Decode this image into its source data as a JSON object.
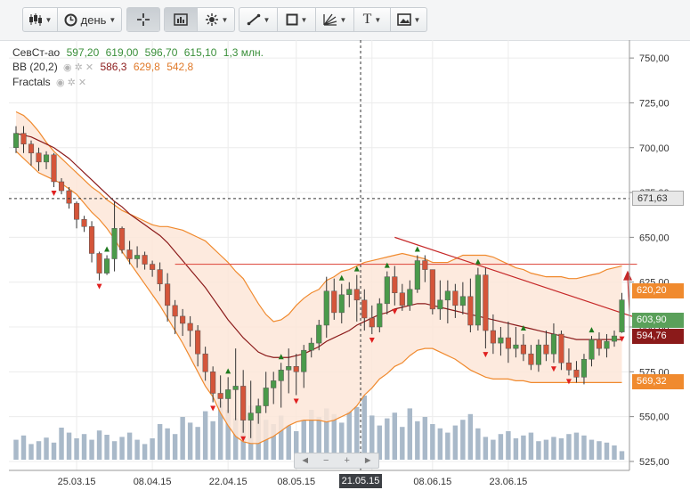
{
  "toolbar": {
    "buttons": [
      {
        "name": "chart-type-button",
        "icon": "candlestick-icon",
        "caret": true
      },
      {
        "name": "interval-button",
        "icon": "clock-icon",
        "label": "день",
        "caret": true
      },
      {
        "name": "crosshair-button",
        "icon": "crosshair-icon",
        "active": true
      },
      {
        "name": "chart-style-button",
        "icon": "chart-box-icon",
        "active": true
      },
      {
        "name": "theme-button",
        "icon": "sun-icon",
        "caret": true
      },
      {
        "name": "line-tool-button",
        "icon": "pencil-line-icon",
        "caret": true
      },
      {
        "name": "shape-tool-button",
        "icon": "square-icon",
        "caret": true
      },
      {
        "name": "fib-tool-button",
        "icon": "fan-icon",
        "caret": true
      },
      {
        "name": "text-tool-button",
        "icon": "text-icon",
        "label": "T",
        "caret": true
      },
      {
        "name": "image-tool-button",
        "icon": "image-icon",
        "caret": true
      }
    ]
  },
  "legend": {
    "ticker": "СевСт-ао",
    "ohlc": [
      "597,20",
      "619,00",
      "596,70",
      "615,10"
    ],
    "volume": "1,3 млн.",
    "bb_name": "BB (20,2)",
    "bb_values": [
      "586,3",
      "629,8",
      "542,8"
    ],
    "fractals_name": "Fractals"
  },
  "price_tags": [
    {
      "text": "671,63",
      "value": 671.63,
      "bg": "#e8e8e8",
      "color": "#333",
      "border": "#aaa"
    },
    {
      "text": "620,20",
      "value": 620.2,
      "bg": "#f08a2e",
      "color": "#fff"
    },
    {
      "text": "603,90",
      "value": 603.9,
      "bg": "#5aa05a",
      "color": "#fff"
    },
    {
      "text": "594,76",
      "value": 594.76,
      "bg": "#8b1a1a",
      "color": "#fff"
    },
    {
      "text": "569,32",
      "value": 569.32,
      "bg": "#f08a2e",
      "color": "#fff"
    }
  ],
  "crosshair_date": "21.05.15",
  "navigator": {
    "left": "◄",
    "minus": "−",
    "plus": "+",
    "right": "►"
  },
  "colors": {
    "up": "#4a9a4a",
    "down": "#d4553a",
    "band_fill": "#fde6d8",
    "band_line": "#f08a2e",
    "mid_line": "#8b1a1a",
    "volume": "#a9b9c9"
  },
  "chart_data": {
    "type": "candlestick",
    "ylim": [
      520,
      760
    ],
    "yticks": [
      525,
      550,
      575,
      600,
      625,
      650,
      675,
      700,
      725,
      750
    ],
    "ytick_labels": [
      "525,00",
      "550,00",
      "575,00",
      "600,00",
      "625,00",
      "650,00",
      "675,00",
      "700,00",
      "725,00",
      "750,00"
    ],
    "xtick_labels": [
      {
        "idx": 8,
        "label": "25.03.15"
      },
      {
        "idx": 18,
        "label": "08.04.15"
      },
      {
        "idx": 28,
        "label": "22.04.15"
      },
      {
        "idx": 37,
        "label": "08.05.15"
      },
      {
        "idx": 47,
        "label": "21.05.15"
      },
      {
        "idx": 55,
        "label": "08.06.15"
      },
      {
        "idx": 65,
        "label": "23.06.15"
      }
    ],
    "crosshair": {
      "idx": 45.5,
      "price": 671.63
    },
    "candles": [
      [
        700,
        712,
        697,
        708
      ],
      [
        708,
        712,
        697,
        702
      ],
      [
        702,
        704,
        690,
        697
      ],
      [
        697,
        700,
        687,
        692
      ],
      [
        692,
        698,
        688,
        696
      ],
      [
        696,
        697,
        678,
        681
      ],
      [
        681,
        683,
        674,
        676
      ],
      [
        676,
        678,
        666,
        669
      ],
      [
        669,
        670,
        655,
        660
      ],
      [
        660,
        662,
        653,
        656
      ],
      [
        656,
        659,
        636,
        641
      ],
      [
        641,
        642,
        626,
        630
      ],
      [
        630,
        640,
        629,
        638
      ],
      [
        638,
        670,
        631,
        655
      ],
      [
        655,
        656,
        641,
        643
      ],
      [
        643,
        648,
        635,
        638
      ],
      [
        638,
        645,
        633,
        640
      ],
      [
        640,
        642,
        632,
        635
      ],
      [
        635,
        637,
        628,
        632
      ],
      [
        632,
        636,
        620,
        624
      ],
      [
        624,
        630,
        603,
        612
      ],
      [
        612,
        615,
        596,
        606
      ],
      [
        606,
        610,
        595,
        602
      ],
      [
        602,
        606,
        589,
        598
      ],
      [
        598,
        601,
        578,
        585
      ],
      [
        585,
        589,
        570,
        575
      ],
      [
        575,
        578,
        558,
        563
      ],
      [
        563,
        573,
        555,
        560
      ],
      [
        560,
        572,
        552,
        565
      ],
      [
        565,
        588,
        548,
        567
      ],
      [
        567,
        576,
        541,
        548
      ],
      [
        548,
        570,
        538,
        552
      ],
      [
        552,
        560,
        546,
        556
      ],
      [
        556,
        575,
        552,
        566
      ],
      [
        566,
        575,
        557,
        570
      ],
      [
        570,
        580,
        555,
        576
      ],
      [
        576,
        588,
        563,
        578
      ],
      [
        578,
        585,
        562,
        575
      ],
      [
        575,
        590,
        566,
        587
      ],
      [
        587,
        594,
        583,
        591
      ],
      [
        591,
        604,
        587,
        601
      ],
      [
        601,
        628,
        594,
        620
      ],
      [
        620,
        627,
        604,
        608
      ],
      [
        608,
        624,
        602,
        618
      ],
      [
        618,
        625,
        611,
        621
      ],
      [
        621,
        629,
        603,
        615
      ],
      [
        615,
        621,
        598,
        605
      ],
      [
        605,
        612,
        596,
        600
      ],
      [
        600,
        616,
        597,
        613
      ],
      [
        613,
        631,
        607,
        628
      ],
      [
        628,
        634,
        612,
        619
      ],
      [
        619,
        624,
        609,
        612
      ],
      [
        612,
        626,
        609,
        621
      ],
      [
        621,
        640,
        619,
        637
      ],
      [
        637,
        640,
        625,
        632
      ],
      [
        632,
        632,
        607,
        610
      ],
      [
        610,
        626,
        604,
        615
      ],
      [
        615,
        626,
        602,
        620
      ],
      [
        620,
        624,
        605,
        612
      ],
      [
        612,
        625,
        607,
        617
      ],
      [
        617,
        627,
        597,
        601
      ],
      [
        601,
        633,
        598,
        629
      ],
      [
        629,
        633,
        588,
        598
      ],
      [
        598,
        607,
        585,
        591
      ],
      [
        591,
        600,
        584,
        594
      ],
      [
        594,
        603,
        580,
        588
      ],
      [
        588,
        600,
        583,
        590
      ],
      [
        590,
        596,
        581,
        585
      ],
      [
        585,
        590,
        576,
        579
      ],
      [
        579,
        593,
        575,
        590
      ],
      [
        590,
        598,
        581,
        585
      ],
      [
        585,
        602,
        580,
        596
      ],
      [
        596,
        598,
        576,
        580
      ],
      [
        580,
        588,
        573,
        576
      ],
      [
        576,
        581,
        569,
        572
      ],
      [
        572,
        585,
        568,
        582
      ],
      [
        582,
        595,
        578,
        593
      ],
      [
        593,
        597,
        584,
        588
      ],
      [
        588,
        596,
        583,
        592
      ],
      [
        592,
        598,
        589,
        595
      ],
      [
        597.2,
        619,
        596.7,
        615.1
      ]
    ],
    "volumes": [
      0.28,
      0.34,
      0.22,
      0.26,
      0.31,
      0.24,
      0.45,
      0.38,
      0.3,
      0.36,
      0.28,
      0.41,
      0.35,
      0.26,
      0.32,
      0.38,
      0.28,
      0.22,
      0.3,
      0.5,
      0.44,
      0.36,
      0.6,
      0.52,
      0.46,
      0.68,
      0.54,
      0.82,
      0.7,
      0.58,
      0.95,
      0.76,
      0.64,
      0.56,
      0.5,
      0.62,
      0.48,
      0.4,
      0.55,
      0.7,
      0.6,
      0.72,
      0.64,
      0.52,
      0.68,
      0.74,
      0.9,
      0.62,
      0.48,
      0.58,
      0.66,
      0.46,
      0.72,
      0.54,
      0.6,
      0.5,
      0.44,
      0.38,
      0.48,
      0.56,
      0.64,
      0.44,
      0.32,
      0.28,
      0.36,
      0.4,
      0.3,
      0.34,
      0.38,
      0.26,
      0.28,
      0.32,
      0.3,
      0.36,
      0.38,
      0.34,
      0.28,
      0.26,
      0.24,
      0.2,
      0.12
    ],
    "bb_upper": [
      720,
      718,
      714,
      709,
      703,
      698,
      694,
      690,
      686,
      682,
      678,
      675,
      671,
      668,
      665,
      663,
      661,
      659,
      657,
      656,
      656,
      655,
      654,
      652,
      650,
      648,
      644,
      640,
      636,
      631,
      627,
      620,
      613,
      607,
      603,
      604,
      607,
      612,
      616,
      619,
      621,
      626,
      628,
      631,
      632,
      634,
      636,
      637,
      638,
      639,
      640,
      641,
      640,
      639,
      638,
      636,
      636,
      636,
      638,
      640,
      640,
      640,
      640,
      639,
      637,
      635,
      633,
      632,
      630,
      629,
      628,
      628,
      628,
      627,
      627,
      628,
      629,
      630,
      632,
      633,
      634
    ],
    "bb_mid": [
      708,
      707,
      706,
      704,
      702,
      700,
      697,
      694,
      690,
      686,
      682,
      678,
      674,
      670,
      667,
      663,
      660,
      657,
      654,
      651,
      647,
      642,
      637,
      632,
      627,
      622,
      616,
      610,
      604,
      599,
      594,
      590,
      586,
      584,
      583,
      583,
      583,
      584,
      585,
      587,
      589,
      592,
      594,
      596,
      598,
      601,
      603,
      605,
      607,
      608,
      610,
      611,
      612,
      613,
      613,
      612,
      611,
      610,
      609,
      608,
      607,
      606,
      605,
      604,
      603,
      602,
      601,
      600,
      599,
      598,
      597,
      596,
      595,
      594,
      593,
      593,
      593,
      593,
      593,
      593,
      593
    ],
    "bb_lower": [
      698,
      694,
      690,
      686,
      684,
      682,
      680,
      677,
      674,
      669,
      664,
      660,
      655,
      649,
      642,
      636,
      630,
      624,
      618,
      612,
      605,
      598,
      591,
      583,
      575,
      567,
      561,
      552,
      545,
      539,
      536,
      535,
      535,
      537,
      539,
      542,
      545,
      547,
      548,
      548,
      548,
      547,
      548,
      550,
      552,
      556,
      562,
      566,
      571,
      574,
      578,
      580,
      584,
      587,
      588,
      588,
      586,
      584,
      582,
      579,
      576,
      574,
      572,
      571,
      571,
      571,
      570,
      570,
      569,
      569,
      569,
      569,
      569,
      569,
      569,
      569,
      569,
      569,
      569,
      569,
      569
    ],
    "fractals_up": [
      12,
      28,
      35,
      43,
      45,
      49,
      53,
      61,
      67,
      76
    ],
    "fractals_down": [
      5,
      11,
      26,
      30,
      37,
      47,
      50,
      62,
      71,
      73,
      80
    ],
    "hline": {
      "from": 21,
      "to": 82,
      "price": 635
    },
    "trend": {
      "from": [
        50,
        650
      ],
      "to": [
        82,
        605
      ]
    },
    "arrow_up_at": {
      "idx": 81,
      "price": 629
    },
    "arrow_down_at": {
      "idx": 80,
      "price": 613
    }
  }
}
